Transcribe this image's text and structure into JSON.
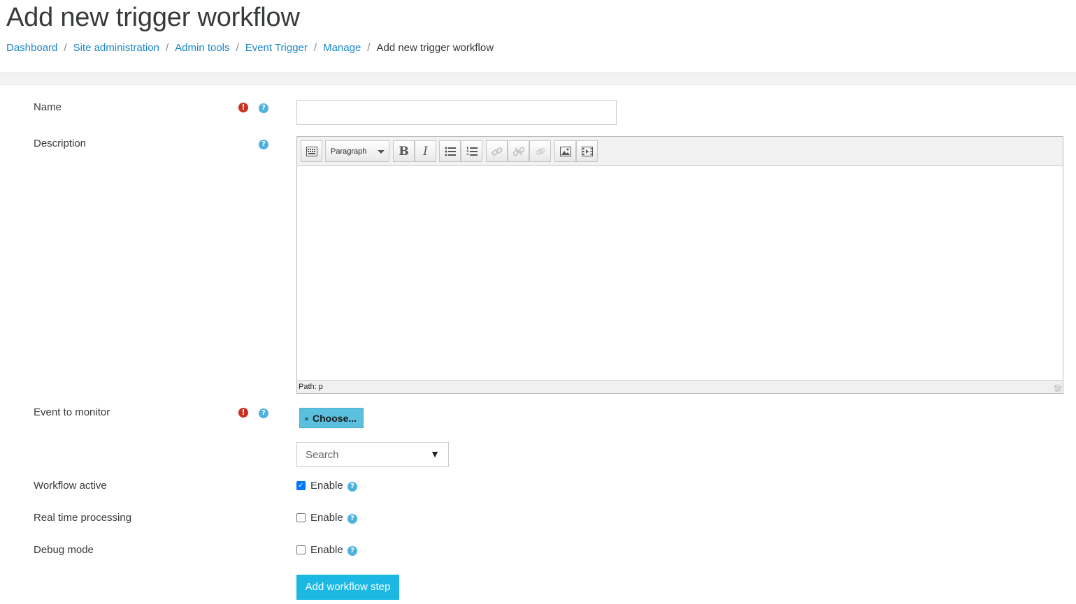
{
  "page_title": "Add new trigger workflow",
  "breadcrumb": {
    "items": [
      {
        "label": "Dashboard"
      },
      {
        "label": "Site administration"
      },
      {
        "label": "Admin tools"
      },
      {
        "label": "Event Trigger"
      },
      {
        "label": "Manage"
      }
    ],
    "separator": "/",
    "current": "Add new trigger workflow"
  },
  "form": {
    "name": {
      "label": "Name",
      "value": ""
    },
    "description": {
      "label": "Description",
      "toolbar": {
        "paragraph_label": "Paragraph",
        "bold": "B",
        "italic": "I"
      },
      "status_path": "Path: p"
    },
    "event": {
      "label": "Event to monitor",
      "choose_label": "Choose...",
      "choose_x": "×",
      "search_placeholder": "Search",
      "search_arrow": "▼"
    },
    "workflow_active": {
      "label": "Workflow active",
      "check_label": "Enable",
      "checked": true
    },
    "realtime": {
      "label": "Real time processing",
      "check_label": "Enable",
      "checked": false
    },
    "debug": {
      "label": "Debug mode",
      "check_label": "Enable",
      "checked": false
    },
    "submit_label": "Add workflow step"
  },
  "icons": {
    "required": "!",
    "help": "?"
  },
  "colors": {
    "link": "#1e88c7",
    "required": "#ca3120",
    "help": "#4fb2de",
    "primary_button": "#1bb8e4",
    "choose_button": "#5bc0de"
  }
}
